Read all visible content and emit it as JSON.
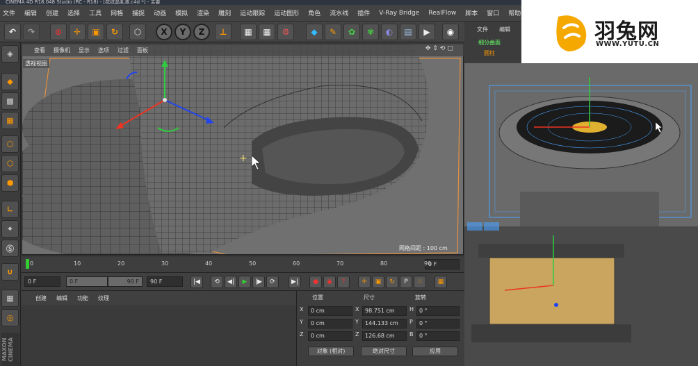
{
  "window": {
    "title": "CINEMA 4D R18.048 Studio (RC - R18) - [花纹晶乳液.c4d *] - 主要"
  },
  "menu": [
    "文件",
    "编辑",
    "创建",
    "选择",
    "工具",
    "网格",
    "捕捉",
    "动画",
    "模拟",
    "渲染",
    "雕刻",
    "运动跟踪",
    "运动图形",
    "角色",
    "流水线",
    "插件",
    "V-Ray Bridge",
    "RealFlow",
    "脚本",
    "窗口",
    "帮助"
  ],
  "toolbar": {
    "axis_buttons": [
      "X",
      "Y",
      "Z"
    ]
  },
  "viewport": {
    "menu": [
      "查看",
      "摄像机",
      "显示",
      "选项",
      "过滤",
      "面板"
    ],
    "label": "透视视图",
    "grid_spacing": "网格间距 : 100 cm"
  },
  "timeline": {
    "ticks": [
      "0",
      "10",
      "20",
      "30",
      "40",
      "50",
      "60",
      "70",
      "80",
      "90"
    ],
    "current_frame": "0 F"
  },
  "playback": {
    "start": "0 F",
    "range_start": "0 F",
    "range_end": "90 F",
    "end": "90 F"
  },
  "material_panel": {
    "menu": [
      "创建",
      "编辑",
      "功能",
      "纹理"
    ]
  },
  "coordinates": {
    "headers": {
      "position": "位置",
      "size": "尺寸",
      "rotation": "旋转"
    },
    "rows": [
      {
        "pos_label": "X",
        "pos": "0 cm",
        "size_label": "X",
        "size": "98.751 cm",
        "rot_label": "H",
        "rot": "0 °"
      },
      {
        "pos_label": "Y",
        "pos": "0 cm",
        "size_label": "Y",
        "size": "144.133 cm",
        "rot_label": "P",
        "rot": "0 °"
      },
      {
        "pos_label": "Z",
        "pos": "0 cm",
        "size_label": "Z",
        "size": "126.68 cm",
        "rot_label": "B",
        "rot": "0 °"
      }
    ],
    "mode": "对象 (相对)",
    "size_mode": "绝对尺寸",
    "apply": "应用"
  },
  "object_manager": {
    "menu": [
      "文件",
      "编辑"
    ],
    "items": [
      "细分曲面",
      "圆柱"
    ]
  },
  "branding": {
    "logo_chinese": "羽兔网",
    "logo_url": "WWW.YUTU.CN",
    "brand_color": "#f5a800",
    "maxon": "MAXON CINEMA"
  }
}
